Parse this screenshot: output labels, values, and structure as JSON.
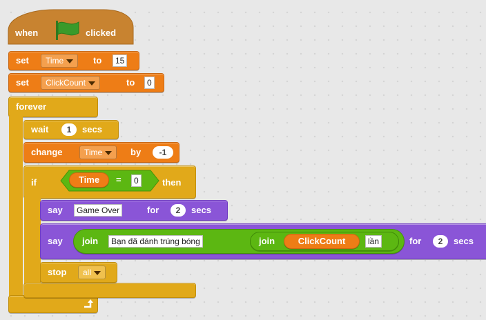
{
  "colors": {
    "control": "#e1a91a",
    "data": "#ee7d16",
    "looks": "#8a55d7",
    "operators": "#5cb712",
    "events": "#c88330",
    "flag": "#3a9a2a",
    "canvas": "#e8e8e8"
  },
  "script": {
    "hat": {
      "when": "when",
      "flag_icon": "green-flag-icon",
      "clicked": "clicked"
    },
    "set_time": {
      "set": "set",
      "variable": "Time",
      "to": "to",
      "value": "15"
    },
    "set_clickcount": {
      "set": "set",
      "variable": "ClickCount",
      "to": "to",
      "value": "0"
    },
    "forever": {
      "label": "forever",
      "loop_icon": "loop-arrow-icon"
    },
    "wait": {
      "wait": "wait",
      "value": "1",
      "secs": "secs"
    },
    "change_time": {
      "change": "change",
      "variable": "Time",
      "by": "by",
      "value": "-1"
    },
    "if_block": {
      "if": "if",
      "reporter": "Time",
      "equals": "=",
      "value": "0",
      "then": "then"
    },
    "say1": {
      "say": "say",
      "text": "Game Over",
      "for": "for",
      "value": "2",
      "secs": "secs"
    },
    "say2": {
      "say": "say",
      "join1": "join",
      "text1": "Bạn đã đánh trúng bóng",
      "join2": "join",
      "reporter": "ClickCount",
      "text2": "lần",
      "for": "for",
      "value": "2",
      "secs": "secs"
    },
    "stop": {
      "stop": "stop",
      "option": "all"
    }
  }
}
